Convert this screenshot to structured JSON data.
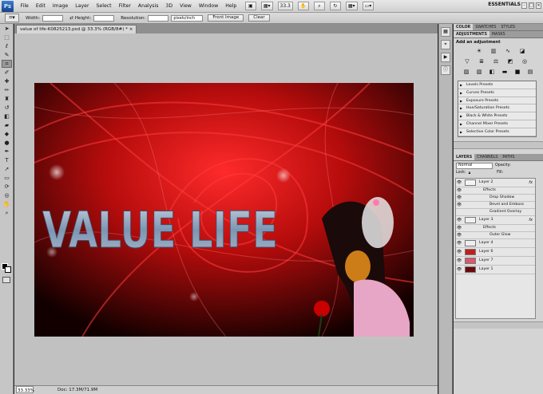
{
  "menubar": {
    "app_logo": "Ps",
    "items": [
      "File",
      "Edit",
      "Image",
      "Layer",
      "Select",
      "Filter",
      "Analysis",
      "3D",
      "View",
      "Window",
      "Help"
    ],
    "zoom_value": "33.3",
    "workspace": "ESSENTIALS"
  },
  "options": {
    "width_label": "Width:",
    "height_label": "Height:",
    "resolution_label": "Resolution:",
    "resolution_unit": "pixels/inch",
    "front_image": "Front Image",
    "clear": "Clear"
  },
  "document": {
    "tab_title": "value of life-K0825213.psd @ 33.3% (RGB/8#) *",
    "canvas_text": "VALUE LIFE",
    "zoom_status": "33.33%",
    "doc_info": "Doc: 17.3M/71.9M"
  },
  "panels": {
    "top_tabs": [
      "COLOR",
      "SWATCHES",
      "STYLES"
    ],
    "adj_tabs": [
      "ADJUSTMENTS",
      "MASKS"
    ],
    "adj_title": "Add an adjustment",
    "presets": [
      "Levels Presets",
      "Curves Presets",
      "Exposure Presets",
      "Hue/Saturation Presets",
      "Black & White Presets",
      "Channel Mixer Presets",
      "Selective Color Presets"
    ],
    "layer_tabs": [
      "LAYERS",
      "CHANNELS",
      "PATHS"
    ],
    "blend_mode": "Normal",
    "opacity_label": "Opacity:",
    "lock_label": "Lock:",
    "fill_label": "Fill:"
  },
  "layers": [
    {
      "name": "Layer 2",
      "fx": "fx",
      "thumb": "#f4f4f4",
      "kind": "layer"
    },
    {
      "name": "Effects",
      "kind": "sub"
    },
    {
      "name": "Drop Shadow",
      "kind": "sub2"
    },
    {
      "name": "Bevel and Emboss",
      "kind": "sub2"
    },
    {
      "name": "Gradient Overlay",
      "kind": "sub2"
    },
    {
      "name": "Layer 3",
      "fx": "fx",
      "thumb": "#f0f0f0",
      "kind": "layer"
    },
    {
      "name": "Effects",
      "kind": "sub"
    },
    {
      "name": "Outer Glow",
      "kind": "sub2"
    },
    {
      "name": "Layer 4",
      "thumb": "#eeeeee",
      "kind": "layer"
    },
    {
      "name": "Layer 6",
      "thumb": "#c41d1d",
      "kind": "layer"
    },
    {
      "name": "Layer 7",
      "thumb": "#d65a6a",
      "kind": "layer"
    },
    {
      "name": "Layer 1",
      "thumb": "#6a0b0b",
      "kind": "layer"
    }
  ]
}
